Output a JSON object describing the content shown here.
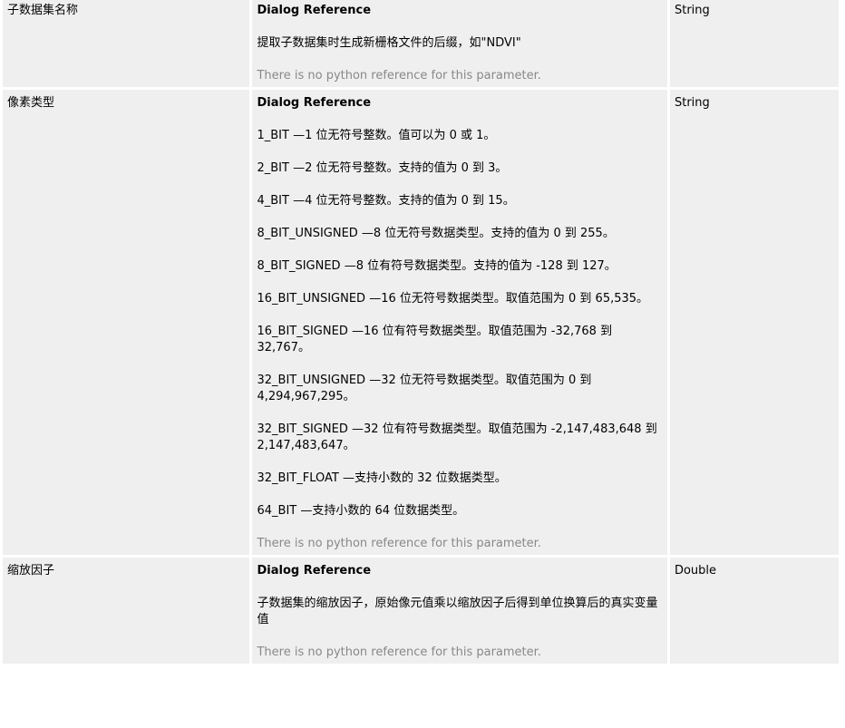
{
  "rows": [
    {
      "name": "子数据集名称",
      "dialog_reference_label": "Dialog Reference",
      "descriptions": [
        "提取子数据集时生成新栅格文件的后缀，如\"NDVI\""
      ],
      "python_note": "There is no python reference for this parameter.",
      "data_type": "String"
    },
    {
      "name": "像素类型",
      "dialog_reference_label": "Dialog Reference",
      "descriptions": [
        "1_BIT —1 位无符号整数。值可以为 0 或 1。",
        "2_BIT —2 位无符号整数。支持的值为 0 到 3。",
        "4_BIT —4 位无符号整数。支持的值为 0 到 15。",
        "8_BIT_UNSIGNED —8 位无符号数据类型。支持的值为 0 到 255。",
        "8_BIT_SIGNED —8 位有符号数据类型。支持的值为 -128 到 127。",
        "16_BIT_UNSIGNED —16 位无符号数据类型。取值范围为 0 到 65,535。",
        "16_BIT_SIGNED —16 位有符号数据类型。取值范围为 -32,768 到 32,767。",
        "32_BIT_UNSIGNED —32 位无符号数据类型。取值范围为 0 到 4,294,967,295。",
        "32_BIT_SIGNED —32 位有符号数据类型。取值范围为 -2,147,483,648 到 2,147,483,647。",
        "32_BIT_FLOAT —支持小数的 32 位数据类型。",
        "64_BIT —支持小数的 64 位数据类型。"
      ],
      "python_note": "There is no python reference for this parameter.",
      "data_type": "String"
    },
    {
      "name": "缩放因子",
      "dialog_reference_label": "Dialog Reference",
      "descriptions": [
        "子数据集的缩放因子，原始像元值乘以缩放因子后得到单位换算后的真实变量值"
      ],
      "python_note": "There is no python reference for this parameter.",
      "data_type": "Double"
    }
  ]
}
